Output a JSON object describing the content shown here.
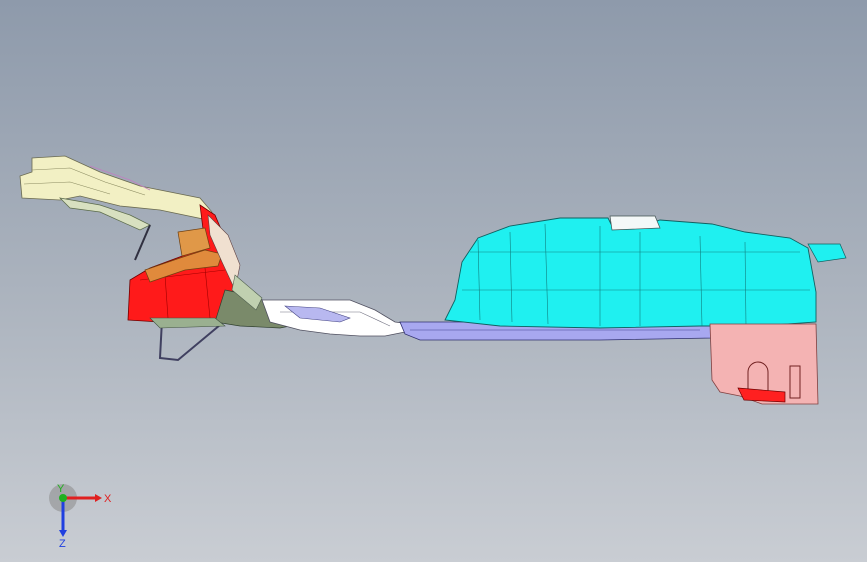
{
  "viewport": {
    "background_top": "#8e9aab",
    "background_bottom": "#c9cdd3"
  },
  "model": {
    "parts": [
      {
        "name": "front-bracket",
        "color": "#f2f0c4"
      },
      {
        "name": "front-mount",
        "color": "#ff1a1a"
      },
      {
        "name": "mount-cap",
        "color": "#e08a3c"
      },
      {
        "name": "floor-pan",
        "color": "#ffffff"
      },
      {
        "name": "floor-rail",
        "color": "#a8a8f0"
      },
      {
        "name": "fuel-tank",
        "color": "#1ff0f0"
      },
      {
        "name": "rear-bracket",
        "color": "#f4b3b3"
      }
    ]
  },
  "triad": {
    "x_label": "X",
    "y_label": "Y",
    "z_label": "Z",
    "x_color": "#e02020",
    "y_color": "#20b020",
    "z_color": "#2040e0"
  }
}
